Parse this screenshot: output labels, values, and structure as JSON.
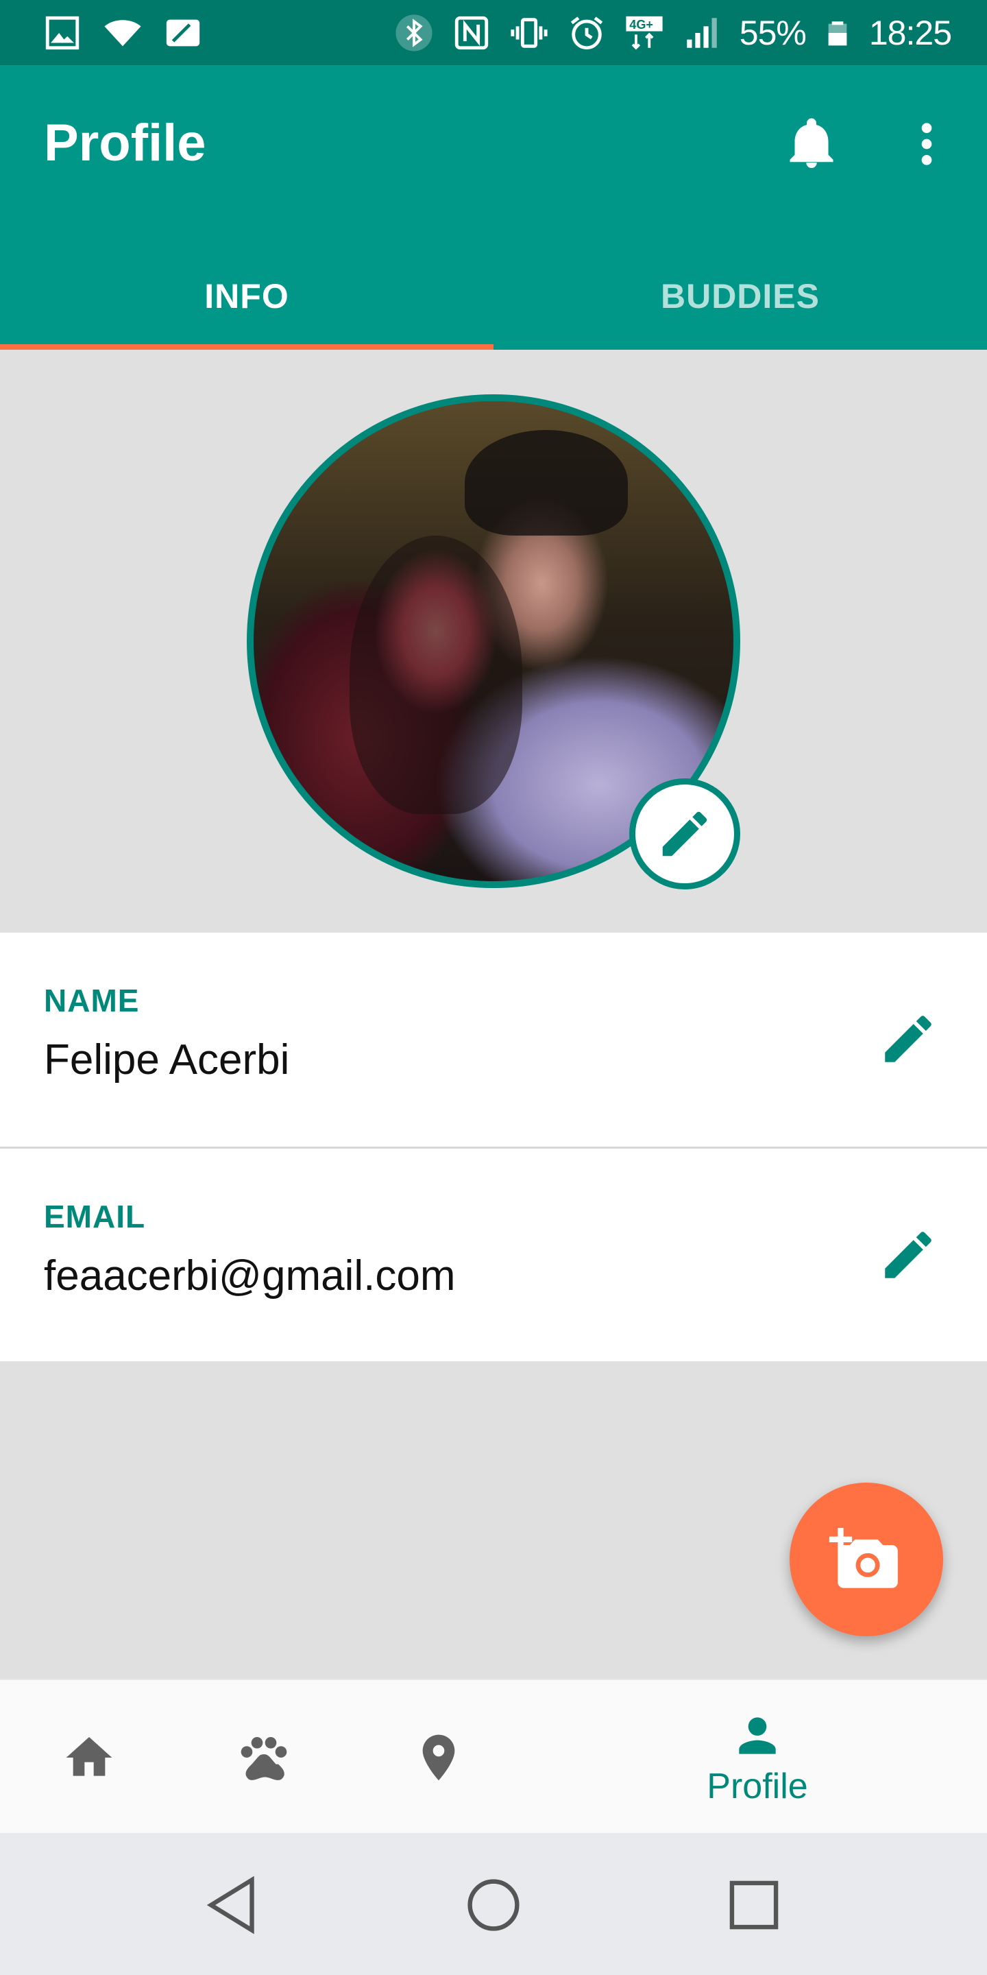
{
  "status_bar": {
    "battery_percent": "55%",
    "time": "18:25",
    "network_badge": "4G+",
    "icons": [
      "gallery-icon",
      "wifi-icon",
      "sim-icon",
      "bluetooth-icon",
      "nfc-icon",
      "vibrate-icon",
      "alarm-icon",
      "network-4g-icon",
      "signal-icon",
      "battery-icon"
    ]
  },
  "app_bar": {
    "title": "Profile",
    "actions": [
      "bell-icon",
      "more-vert-icon"
    ]
  },
  "tabs": [
    {
      "label": "INFO",
      "active": true
    },
    {
      "label": "BUDDIES",
      "active": false
    }
  ],
  "profile": {
    "photo": "profile-photo",
    "fields": [
      {
        "label": "NAME",
        "value": "Felipe Acerbi"
      },
      {
        "label": "EMAIL",
        "value": "feaacerbi@gmail.com"
      }
    ]
  },
  "bottom_nav": {
    "items": [
      {
        "icon": "home-icon",
        "label": ""
      },
      {
        "icon": "paw-icon",
        "label": ""
      },
      {
        "icon": "location-pin-icon",
        "label": ""
      },
      {
        "icon": "person-icon",
        "label": "Profile",
        "active": true
      }
    ]
  },
  "system_nav": [
    "back-icon",
    "home-circle-icon",
    "recents-icon"
  ],
  "colors": {
    "status_bar": "#00796b",
    "primary": "#009688",
    "primary_dark": "#00897b",
    "accent": "#ff7043",
    "background": "#e0e0e0",
    "nav_background": "#fafafa",
    "system_nav": "#e9eaee"
  }
}
